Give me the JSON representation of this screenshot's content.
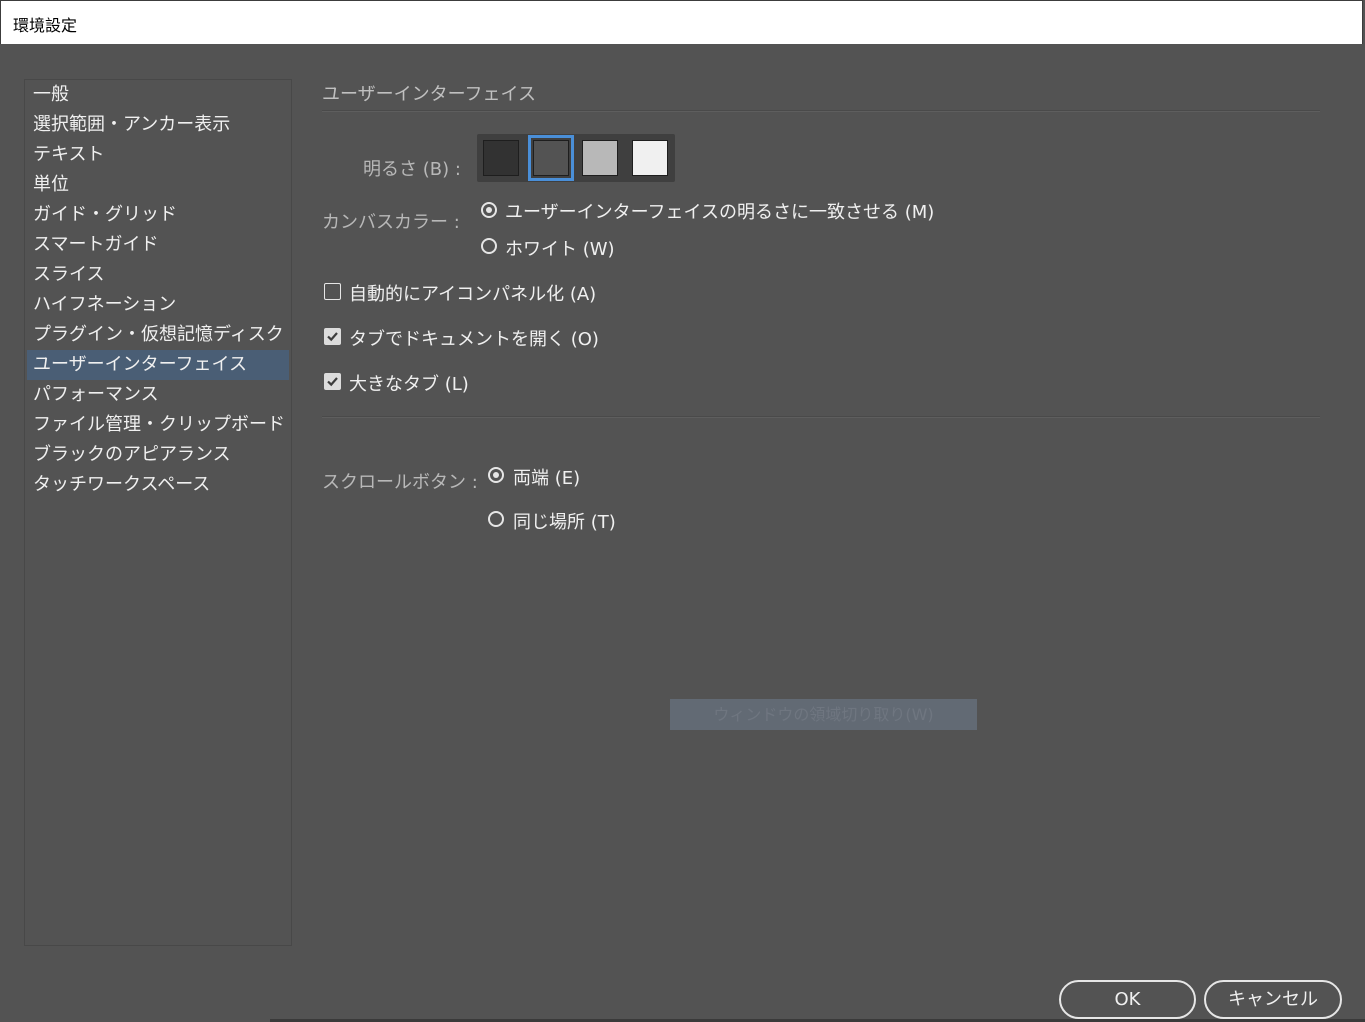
{
  "window": {
    "title": "環境設定"
  },
  "sidebar": {
    "items": [
      {
        "label": "一般"
      },
      {
        "label": "選択範囲・アンカー表示"
      },
      {
        "label": "テキスト"
      },
      {
        "label": "単位"
      },
      {
        "label": "ガイド・グリッド"
      },
      {
        "label": "スマートガイド"
      },
      {
        "label": "スライス"
      },
      {
        "label": "ハイフネーション"
      },
      {
        "label": "プラグイン・仮想記憶ディスク"
      },
      {
        "label": "ユーザーインターフェイス",
        "selected": true
      },
      {
        "label": "パフォーマンス"
      },
      {
        "label": "ファイル管理・クリップボード"
      },
      {
        "label": "ブラックのアピアランス"
      },
      {
        "label": "タッチワークスペース"
      }
    ]
  },
  "panel": {
    "title": "ユーザーインターフェイス",
    "brightness": {
      "label": "明るさ (B) :",
      "swatches": [
        {
          "color": "#323232",
          "selected": false
        },
        {
          "color": "#535353",
          "selected": true
        },
        {
          "color": "#b8b8b8",
          "selected": false
        },
        {
          "color": "#f0f0f0",
          "selected": false
        }
      ]
    },
    "canvas_color": {
      "label": "カンバスカラー :",
      "options": [
        {
          "label": "ユーザーインターフェイスの明るさに一致させる (M)",
          "checked": true
        },
        {
          "label": "ホワイト (W)",
          "checked": false
        }
      ]
    },
    "checkboxes": [
      {
        "label": "自動的にアイコンパネル化 (A)",
        "checked": false
      },
      {
        "label": "タブでドキュメントを開く (O)",
        "checked": true
      },
      {
        "label": "大きなタブ (L)",
        "checked": true
      }
    ],
    "scroll_buttons": {
      "label": "スクロールボタン :",
      "options": [
        {
          "label": "両端 (E)",
          "checked": true
        },
        {
          "label": "同じ場所 (T)",
          "checked": false
        }
      ]
    },
    "capture_button": "ウィンドウの領域切り取り(W)"
  },
  "footer": {
    "ok_label": "OK",
    "cancel_label": "キャンセル"
  },
  "colors": {
    "background": "#535353",
    "selection": "#4a5e75",
    "accent": "#4a8fd8"
  }
}
